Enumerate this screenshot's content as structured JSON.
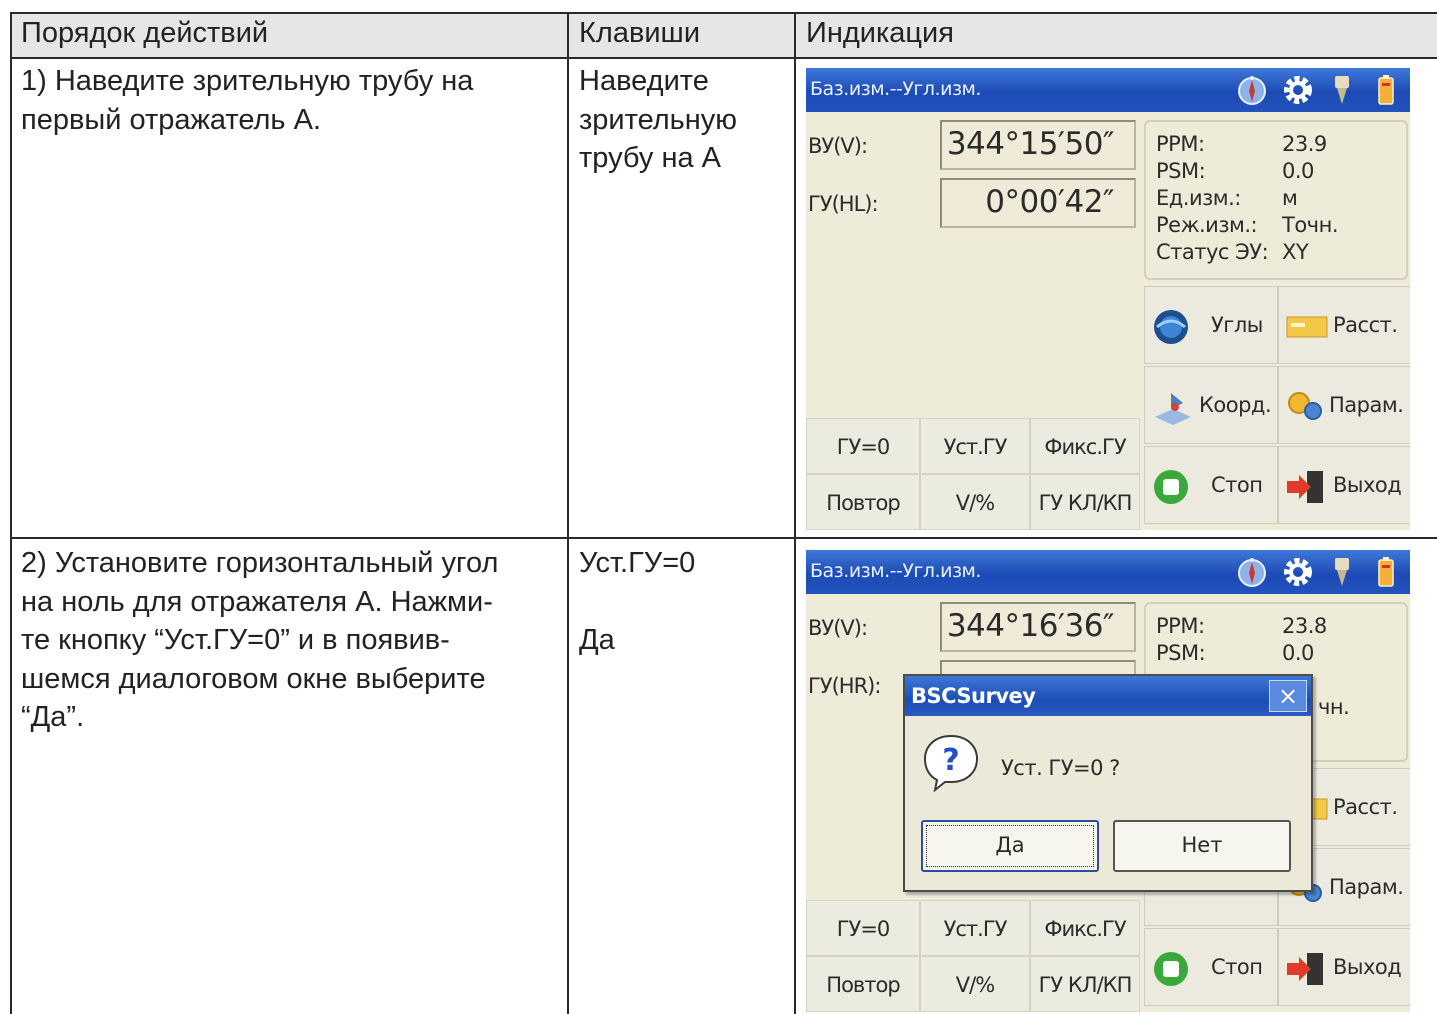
{
  "table": {
    "headers": [
      "Порядок действий",
      "Клавиши",
      "Индикация"
    ],
    "rows": [
      {
        "action_lines": [
          "1)  Наведите зрительную трубу на",
          "первый отражатель А."
        ],
        "keys_lines": [
          "Наведите",
          "зрительную",
          "трубу на А"
        ]
      },
      {
        "action_lines": [
          "2) Установите горизонтальный угол",
          "на ноль для отражателя А. Нажми-",
          "те кнопку “Уст.ГУ=0” и в появив-",
          "шемся диалоговом окне выберите",
          "“Да”."
        ],
        "keys_lines": [
          "Уст.ГУ=0",
          "",
          "Да"
        ]
      }
    ]
  },
  "screens": [
    {
      "title": "Баз.изм.--Угл.изм.",
      "v_label": "ВУ(V):",
      "v_value": "344°15′50″",
      "h_label": "ГУ(HL):",
      "h_value": "0°00′42″",
      "info": [
        {
          "key": "PPM:",
          "value": "23.9"
        },
        {
          "key": "PSM:",
          "value": "0.0"
        },
        {
          "key": "Ед.изм.:",
          "value": "м"
        },
        {
          "key": "Реж.изм.:",
          "value": "Точн."
        },
        {
          "key": "Статус ЭУ:",
          "value": "XY"
        }
      ],
      "buttons": {
        "angles": "Углы",
        "dist": "Расст.",
        "coord": "Коорд.",
        "params": "Парам.",
        "stop": "Стоп",
        "exit": "Выход"
      },
      "fkeys": [
        "ГУ=0",
        "Уст.ГУ",
        "Фикс.ГУ",
        "Повтор",
        "V/%",
        "ГУ КЛ/КП"
      ]
    },
    {
      "title": "Баз.изм.--Угл.изм.",
      "v_label": "ВУ(V):",
      "v_value": "344°16′36″",
      "h_label": "ГУ(HR):",
      "info": [
        {
          "key": "PPM:",
          "value": "23.8"
        },
        {
          "key": "PSM:",
          "value": "0.0"
        },
        {
          "value_partial": "чн."
        }
      ],
      "buttons": {
        "dist": "Расст.",
        "params": "Парам.",
        "stop": "Стоп",
        "exit": "Выход"
      },
      "fkeys": [
        "ГУ=0",
        "Уст.ГУ",
        "Фикс.ГУ",
        "Повтор",
        "V/%",
        "ГУ КЛ/КП"
      ],
      "dialog": {
        "title": "BSCSurvey",
        "close": "×",
        "message": "Уст. ГУ=0 ?",
        "yes": "Да",
        "no": "Нет"
      }
    }
  ]
}
